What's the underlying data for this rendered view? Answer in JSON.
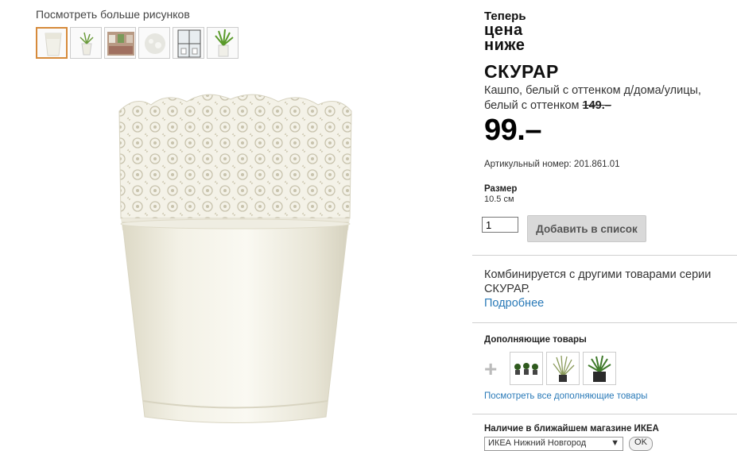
{
  "gallery": {
    "more_label": "Посмотреть больше рисунков",
    "thumbnails": [
      "pot-white-thumb",
      "pot-with-plant-thumb",
      "shelf-thumb",
      "pot-closeup-thumb",
      "window-thumb",
      "plant-grass-thumb"
    ]
  },
  "badge": {
    "line1": "Теперь",
    "line2": "цена",
    "line3": "ниже"
  },
  "product": {
    "name": "СКУРАР",
    "description": "Кашпо, белый с оттенком д/дома/улицы, белый с оттенком",
    "old_price": "149.–",
    "price": "99.–",
    "article": "Артикульный номер: 201.861.01",
    "size_label": "Размер",
    "size_value": "10.5 см"
  },
  "cart": {
    "quantity": "1",
    "add_label": "Добавить в список"
  },
  "combine": {
    "text": "Комбинируется с другими товарами серии СКУРАР.",
    "link": "Подробнее"
  },
  "complementary": {
    "heading": "Дополняющие товары",
    "plus": "+",
    "items": [
      "three-small-plants",
      "grass-plant",
      "potted-grass"
    ],
    "see_all": "Посмотреть все дополняющие товары"
  },
  "availability": {
    "heading": "Наличие в ближайшем магазине ИКЕА",
    "store": "ИКЕА Нижний Новгород",
    "ok_label": "OK"
  },
  "colors": {
    "link": "#2a7ab8",
    "active_thumb": "#d68a3a",
    "button_bg": "#d9d9d9"
  }
}
